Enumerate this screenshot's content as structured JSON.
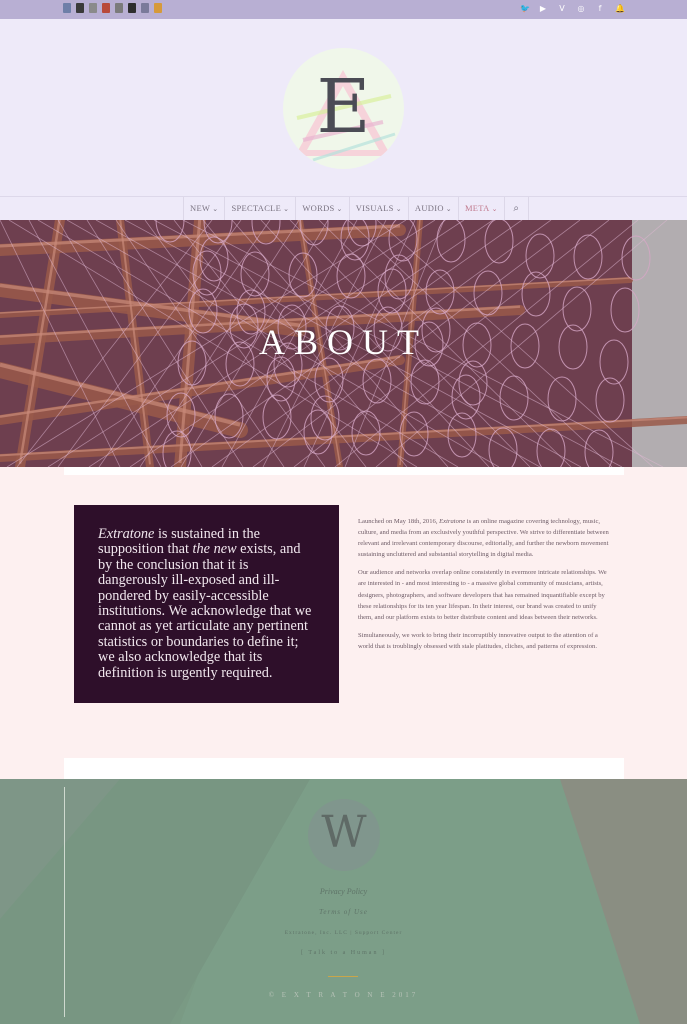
{
  "topbar": {
    "left_icons": [
      {
        "name": "app-icon-1",
        "color": "#6e7fa8"
      },
      {
        "name": "app-icon-2",
        "color": "#3a3a3a"
      },
      {
        "name": "app-icon-3",
        "color": "#8a8a8a"
      },
      {
        "name": "app-icon-4",
        "color": "#b84a3a"
      },
      {
        "name": "app-icon-5",
        "color": "#7b7b7b"
      },
      {
        "name": "app-icon-6",
        "color": "#2e2e2e"
      },
      {
        "name": "app-icon-7",
        "color": "#7a7a9a"
      },
      {
        "name": "app-icon-8",
        "color": "#d69a3a"
      }
    ],
    "social_icons": [
      {
        "name": "twitter-icon",
        "glyph": "🐦"
      },
      {
        "name": "youtube-icon",
        "glyph": "▶"
      },
      {
        "name": "vimeo-icon",
        "glyph": "V"
      },
      {
        "name": "instagram-icon",
        "glyph": "◎"
      },
      {
        "name": "facebook-icon",
        "glyph": "f"
      },
      {
        "name": "notification-icon",
        "glyph": "🔔"
      }
    ]
  },
  "logo": {
    "letter": "E"
  },
  "nav": {
    "items": [
      {
        "label": "NEW",
        "active": false
      },
      {
        "label": "SPECTACLE",
        "active": false
      },
      {
        "label": "WORDS",
        "active": false
      },
      {
        "label": "VISUALS",
        "active": false
      },
      {
        "label": "AUDIO",
        "active": false
      },
      {
        "label": "META",
        "active": true
      }
    ],
    "chevron": "⌄",
    "search_glyph": "⌕"
  },
  "hero": {
    "title": "ABOUT"
  },
  "quote": {
    "italic_1": "Extratone",
    "text_1": " is sustained in the supposition that ",
    "italic_2": "the new",
    "text_2": " exists, and by the conclusion that it is dangerously ill-exposed and ill-pondered by easily-accessible institutions. We acknowledge that we cannot as yet articulate any pertinent statistics or boundaries to define it; we also acknowledge that its definition is urgently required."
  },
  "about_text": {
    "p1_a": "Launched on May 18th, 2016, ",
    "p1_italic": "Extratone",
    "p1_b": " is an online magazine covering technology, music, culture, and media from an exclusively youthful perspective. We strive to differentiate between relevant and irrelevant contemporary discourse, editorially, and further the newborn movement sustaining uncluttered and substantial storytelling in digital media.",
    "p2": "Our audience and networks overlap online consistently in evermore intricate relationships. We are interested in - and most interesting to - a massive global community of musicians, artists, designers, photographers, and software developers that has remained inquantifiable except by these relationships for its ten year lifespan. In their interest, our brand was created to unify them, and our platform exists to better distribute content and ideas between their networks.",
    "p3": "Simultaneously, we work to bring their incorruptibly innovative output to the attention of a world that is troublingly obsessed with stale platitudes, cliches, and patterns of expression."
  },
  "footer": {
    "logo_letter": "W",
    "line_1": "Privacy Policy",
    "line_2": "Terms of Use",
    "line_3": "Extratone, Inc. LLC  |  Support Center",
    "line_4": "[ Talk to a Human ]",
    "copyright": "© E X T R A T O N E 2017"
  }
}
